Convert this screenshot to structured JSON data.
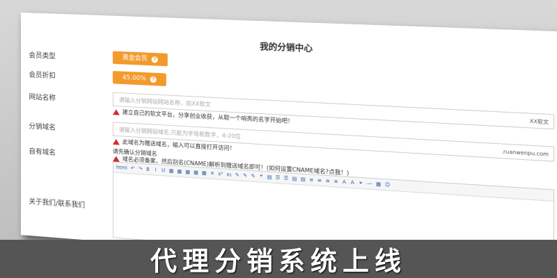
{
  "page": {
    "title": "我的分销中心"
  },
  "rows": {
    "member_type": {
      "label": "会员类型",
      "value": "黄金会员"
    },
    "member_discount": {
      "label": "会员折扣",
      "value": "45.00%"
    },
    "site_name": {
      "label": "网站名称",
      "placeholder": "请输入分销网站网站名称，如XX软文",
      "suffix": "XX软文",
      "hint": "建立自己的软文平台，分享创业收获，从取一个响亮的名字开始吧！"
    },
    "distribution_domain": {
      "label": "分销域名",
      "placeholder": "请输入分销网站域名,只能为字母和数字，4-20位",
      "suffix": ".ruanwenpu.com",
      "hint": "此域名为赠送域名，输入可以直接打开访问！"
    },
    "own_domain": {
      "label": "自有域名",
      "line1": "请先确认分销域名",
      "hint": "域名必须备案，然后别名(CNAME)解析到赠送域名即可！(如何设置CNAME域名?点我！)"
    },
    "about": {
      "label": "关于我们/联系我们"
    }
  },
  "editor": {
    "toolbar": [
      "html",
      "↶",
      "↷",
      "B",
      "I",
      "U",
      "▦",
      "▦",
      "▦",
      "▦",
      "▦",
      "✕",
      "x²",
      "x₂",
      "✎",
      "✎",
      "✎",
      "❝",
      "▤",
      "☰",
      "☰",
      "▤",
      "▤",
      "≡",
      "≡",
      "≡",
      "≡",
      "A",
      "A",
      "⚭",
      "—",
      "▦",
      "☺"
    ]
  },
  "caption": "代理分销系统上线",
  "colors": {
    "accent": "#f39a2d",
    "warn": "#d9262c",
    "caption_bg": "#555555"
  }
}
